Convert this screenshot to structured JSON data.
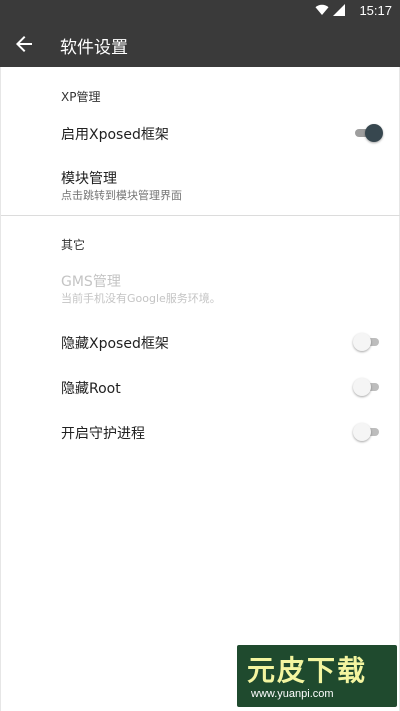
{
  "status_bar": {
    "time": "15:17",
    "icons": [
      "wifi-icon",
      "signal-icon"
    ]
  },
  "toolbar": {
    "title": "软件设置",
    "back_icon": "arrow-back-icon"
  },
  "sections": [
    {
      "header": "XP管理",
      "items": [
        {
          "title": "启用Xposed框架",
          "switch": "on"
        },
        {
          "title": "模块管理",
          "subtitle": "点击跳转到模块管理界面"
        }
      ]
    },
    {
      "header": "其它",
      "items": [
        {
          "title": "GMS管理",
          "subtitle": "当前手机没有Google服务环境。",
          "enabled": false
        },
        {
          "title": "隐藏Xposed框架",
          "switch": "off"
        },
        {
          "title": "隐藏Root",
          "switch": "off"
        },
        {
          "title": "开启守护进程",
          "switch": "off"
        }
      ]
    }
  ],
  "watermark": {
    "text": "元皮下载",
    "url": "www.yuanpi.com"
  },
  "colors": {
    "toolbar": "#3a3a3a",
    "switch_on_thumb": "#37474f",
    "switch_off_thumb": "#f5f5f5",
    "disabled_text": "#c4c4c4"
  }
}
